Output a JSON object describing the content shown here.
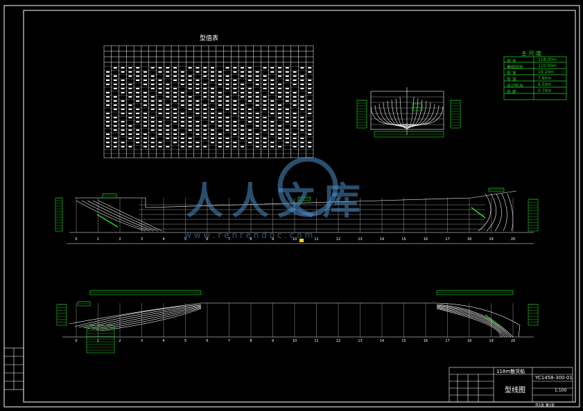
{
  "drawing": {
    "offset_table_title": "型值表",
    "principal_dims_title": "主 尺 度",
    "principal_dims": [
      {
        "label": "总    长",
        "value": "118.00m"
      },
      {
        "label": "垂线间长",
        "value": "110.00m"
      },
      {
        "label": "型    宽",
        "value": "19.20m"
      },
      {
        "label": "型    深",
        "value": "7.80m"
      },
      {
        "label": "设计吃水",
        "value": "6.50m"
      },
      {
        "label": "肋    距",
        "value": "0.70m"
      }
    ],
    "title_block": {
      "project": "118m散货船",
      "drawing_no": "YC1458-300-01",
      "drawing_name": "型线图",
      "scale": "1:100",
      "sheet": "共1张 第1张"
    },
    "watermark": {
      "logo_text": "人人文库",
      "url": "w w w . r e n r e n d o c . c o m"
    },
    "station_labels": [
      "0",
      "1",
      "2",
      "3",
      "4",
      "5",
      "6",
      "7",
      "8",
      "9",
      "10",
      "11",
      "12",
      "13",
      "14",
      "15",
      "16",
      "17",
      "18",
      "19",
      "20"
    ]
  },
  "colors": {
    "background": "#000000",
    "lines": "#ffffff",
    "dimensions": "#22dd22",
    "accent": "#ffdd00"
  }
}
